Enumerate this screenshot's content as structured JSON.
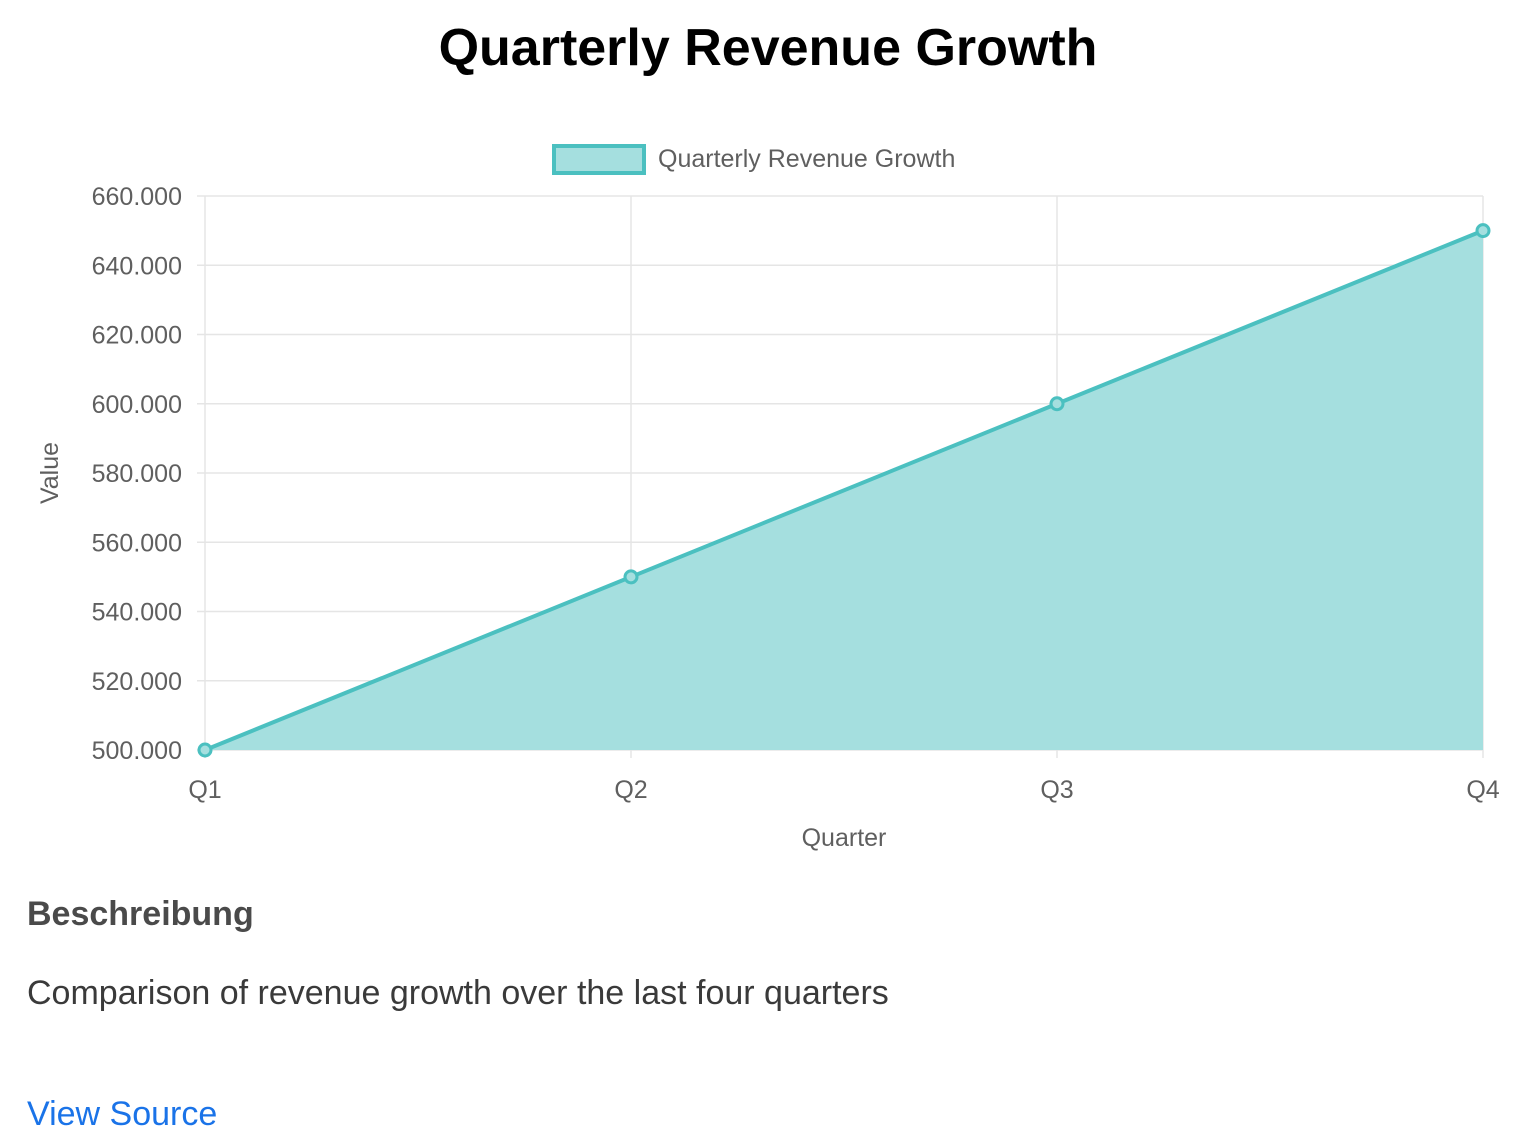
{
  "page": {
    "title": "Quarterly Revenue Growth",
    "description_heading": "Beschreibung",
    "description": "Comparison of revenue growth over the last four quarters",
    "view_source_label": "View Source"
  },
  "chart_data": {
    "type": "area",
    "categories": [
      "Q1",
      "Q2",
      "Q3",
      "Q4"
    ],
    "series": [
      {
        "name": "Quarterly Revenue Growth",
        "values": [
          500000,
          550000,
          600000,
          650000
        ]
      }
    ],
    "xlabel": "Quarter",
    "ylabel": "Value",
    "ylim": [
      500000,
      660000
    ],
    "yticks": [
      500000,
      520000,
      540000,
      560000,
      580000,
      600000,
      620000,
      640000,
      660000
    ],
    "ytick_labels": [
      "500.000",
      "520.000",
      "540.000",
      "560.000",
      "580.000",
      "600.000",
      "620.000",
      "640.000",
      "660.000"
    ],
    "grid": true,
    "legend": "top-center",
    "colors": {
      "line": "#4bc0c0",
      "fill": "#a5dfdf",
      "grid": "#e5e5e5",
      "text": "#5f5f5f"
    }
  }
}
